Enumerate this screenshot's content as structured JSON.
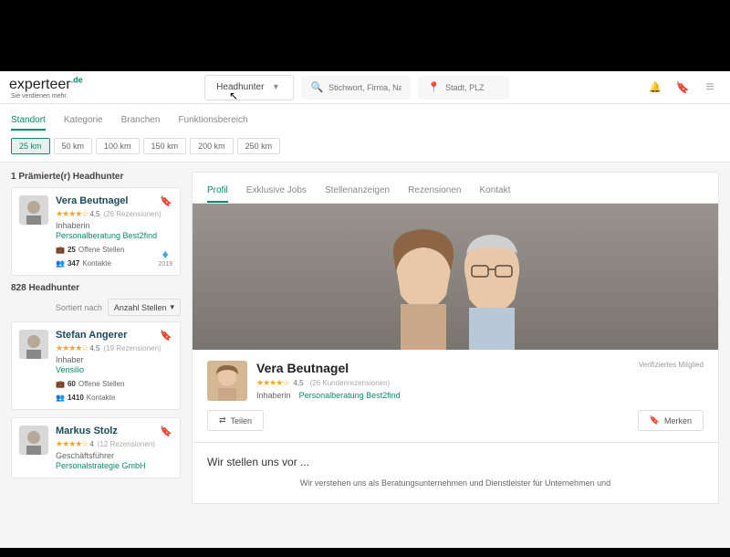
{
  "brand": {
    "name": "experteer",
    "suffix": ".de",
    "tagline": "Sie verdienen mehr."
  },
  "search": {
    "dropdown_label": "Headhunter",
    "keyword_placeholder": "Stichwort, Firma, Name ...",
    "location_placeholder": "Stadt, PLZ"
  },
  "filters": {
    "tabs": [
      "Standort",
      "Kategorie",
      "Branchen",
      "Funktionsbereich"
    ],
    "active_tab": 0,
    "distances": [
      "25 km",
      "50 km",
      "100 km",
      "150 km",
      "200 km",
      "250 km"
    ],
    "active_distance": 0
  },
  "left": {
    "premiere_title": "1 Prämierte(r) Headhunter",
    "count_title": "828 Headhunter",
    "sort_label": "Sortiert nach",
    "sort_value": "Anzahl Stellen",
    "cards": [
      {
        "name": "Vera Beutnagel",
        "rating": "4,5",
        "reviews": "(26 Rezensionen)",
        "role": "Inhaberin",
        "company": "Personalberatung Best2find",
        "open": "25",
        "open_label": "Offene Stellen",
        "contacts": "347",
        "contacts_label": "Kontakte",
        "diamond_year": "2019",
        "premiere": true
      },
      {
        "name": "Stefan Angerer",
        "rating": "4,5",
        "reviews": "(19 Rezensionen)",
        "role": "Inhaber",
        "company": "Vensilio",
        "open": "60",
        "open_label": "Offene Stellen",
        "contacts": "1410",
        "contacts_label": "Kontakte"
      },
      {
        "name": "Markus Stolz",
        "rating": "4",
        "reviews": "(12 Rezensionen)",
        "role": "Geschäftsführer",
        "company": "Personalstrategie GmbH"
      }
    ]
  },
  "profile": {
    "tabs": [
      "Profil",
      "Exklusive Jobs",
      "Stellenanzeigen",
      "Rezensionen",
      "Kontakt"
    ],
    "active_tab": 0,
    "name": "Vera Beutnagel",
    "rating": "4,5",
    "reviews": "(26 Kundenrezensionen)",
    "role": "Inhaberin",
    "company": "Personalberatung Best2find",
    "verified": "Verifiziertes Mitglied",
    "share_label": "Teilen",
    "bookmark_label": "Merken",
    "intro_title": "Wir stellen uns vor ...",
    "intro_text": "Wir verstehen uns als Beratungsunternehmen und Dienstleister für Unternehmen und"
  }
}
